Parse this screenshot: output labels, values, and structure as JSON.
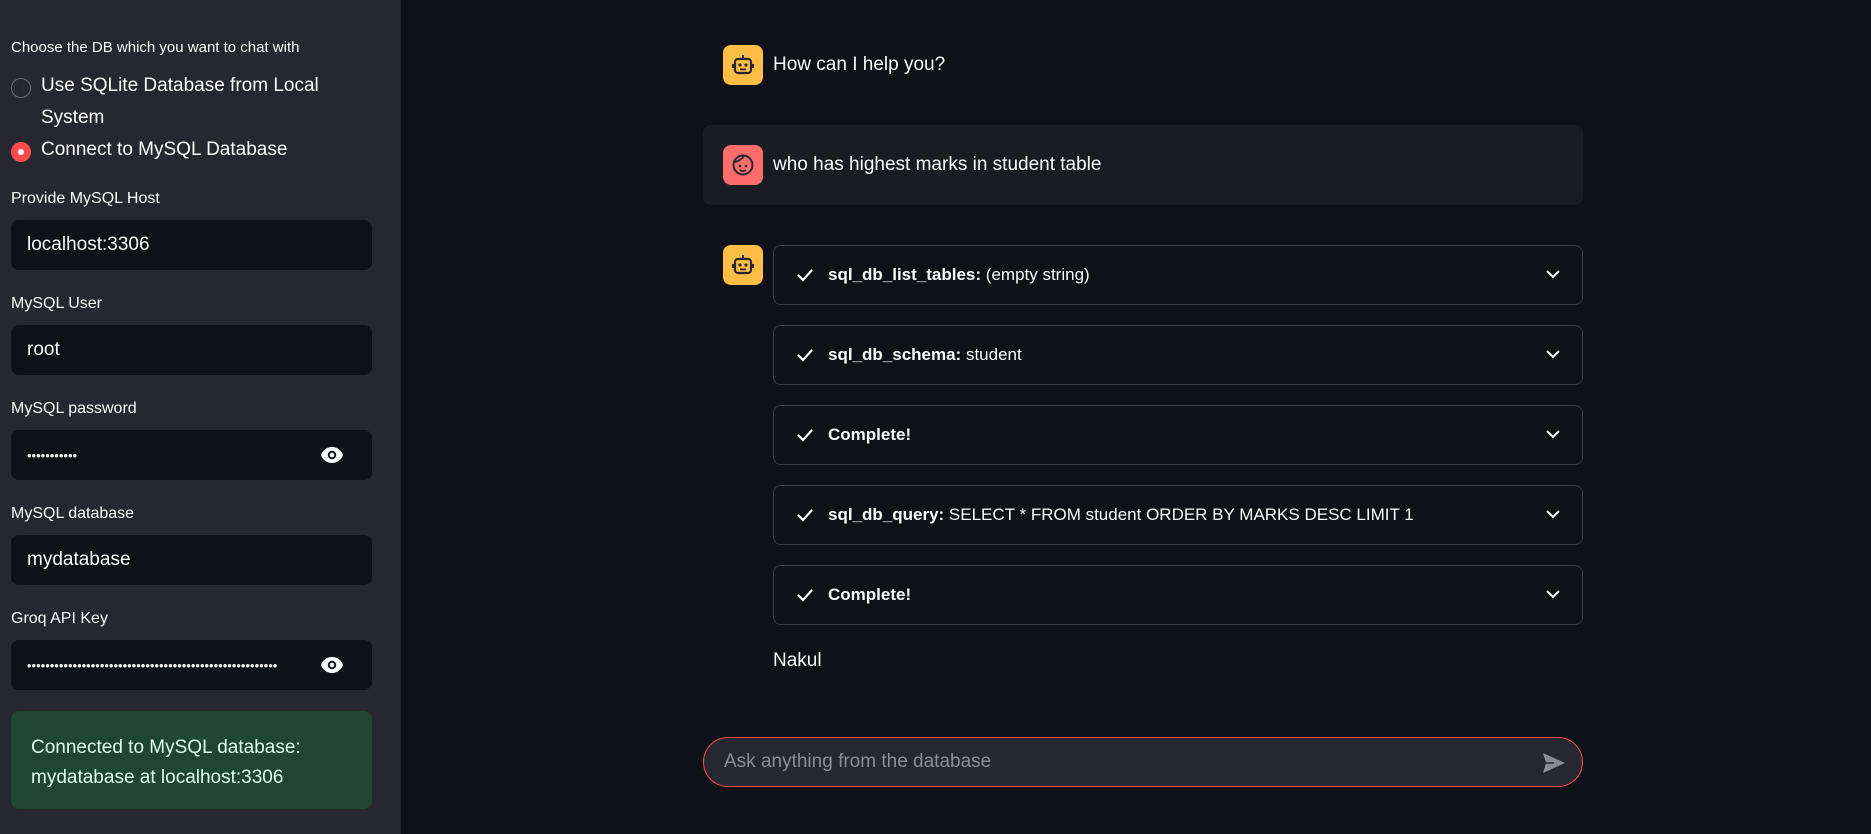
{
  "sidebar": {
    "db_choice_label": "Choose the DB which you want to chat with",
    "options": [
      {
        "line1": "Use SQLite Database from Local",
        "line2": "System",
        "selected": false
      },
      {
        "line1": "Connect to MySQL Database",
        "selected": true
      }
    ],
    "host": {
      "label": "Provide MySQL Host",
      "value": "localhost:3306"
    },
    "user": {
      "label": "MySQL User",
      "value": "root"
    },
    "password": {
      "label": "MySQL password",
      "value": "•••••••••••"
    },
    "database": {
      "label": "MySQL database",
      "value": "mydatabase"
    },
    "api_key": {
      "label": "Groq API Key",
      "value": "•••••••••••••••••••••••••••••••••••••••••••••••••••••••"
    },
    "status": {
      "line1": "Connected to MySQL database:",
      "line2": "mydatabase at localhost:3306"
    },
    "eye_icon": "eye-icon"
  },
  "chat": {
    "bot_greeting": "How can I help you?",
    "user_message": "who has highest marks in student table",
    "steps": [
      {
        "title": "sql_db_list_tables:",
        "detail": " (empty string)"
      },
      {
        "title": "sql_db_schema:",
        "detail": " student"
      },
      {
        "title": "Complete!",
        "detail": ""
      },
      {
        "title": "sql_db_query:",
        "detail": " SELECT * FROM student ORDER BY MARKS DESC LIMIT 1"
      },
      {
        "title": "Complete!",
        "detail": ""
      }
    ],
    "answer": "Nakul",
    "input_placeholder": "Ask anything from the database"
  },
  "colors": {
    "accent": "#ff4b4b",
    "bot_avatar": "#ffbd45",
    "user_avatar": "#ff6c6c",
    "success_bg": "#1f4631"
  }
}
